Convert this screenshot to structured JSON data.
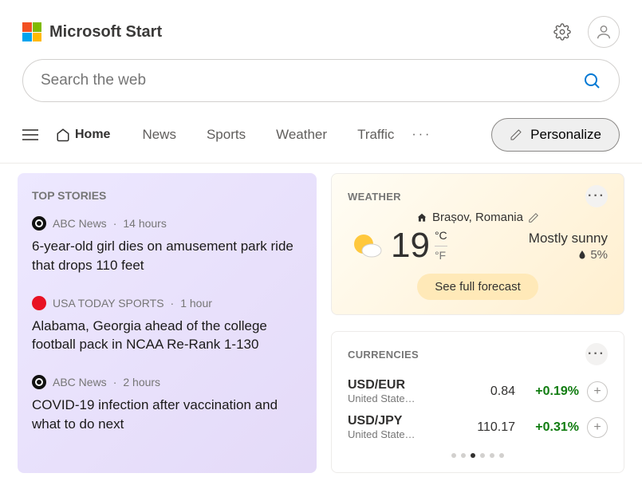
{
  "brand": "Microsoft Start",
  "search": {
    "placeholder": "Search the web"
  },
  "nav": {
    "home": "Home",
    "items": [
      "News",
      "Sports",
      "Weather",
      "Traffic"
    ],
    "personalize": "Personalize"
  },
  "topStories": {
    "title": "TOP STORIES",
    "items": [
      {
        "source": "ABC News",
        "time": "14 hours",
        "headline": "6-year-old girl dies on amusement park ride that drops 110 feet",
        "src_type": "abc"
      },
      {
        "source": "USA TODAY SPORTS",
        "time": "1 hour",
        "headline": "Alabama, Georgia ahead of the college football pack in NCAA Re-Rank 1-130",
        "src_type": "usa"
      },
      {
        "source": "ABC News",
        "time": "2 hours",
        "headline": "COVID-19 infection after vaccination and what to do next",
        "src_type": "abc"
      }
    ]
  },
  "weather": {
    "title": "WEATHER",
    "location": "Brașov, Romania",
    "temp": "19",
    "unit_c": "°C",
    "unit_f": "°F",
    "condition": "Mostly sunny",
    "humidity": "5%",
    "forecast_btn": "See full forecast"
  },
  "currencies": {
    "title": "CURRENCIES",
    "rows": [
      {
        "pair": "USD/EUR",
        "sub": "United State…",
        "val": "0.84",
        "chg": "+0.19%"
      },
      {
        "pair": "USD/JPY",
        "sub": "United State…",
        "val": "110.17",
        "chg": "+0.31%"
      }
    ],
    "active_page": 2,
    "total_pages": 6
  }
}
